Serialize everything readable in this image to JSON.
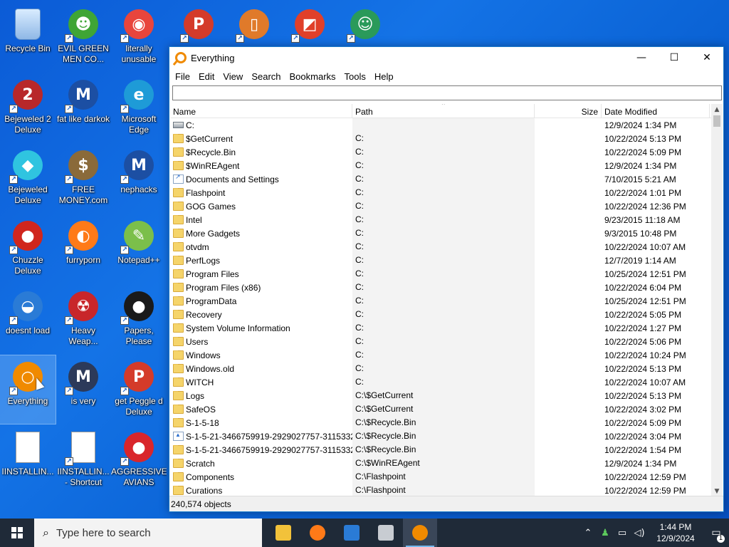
{
  "desktop": {
    "icons": [
      {
        "label": "Recycle Bin",
        "glyph": "",
        "color": "#cfe6ff",
        "shortcut": false
      },
      {
        "label": "EVIL GREEN MEN CO...",
        "glyph": "☻",
        "color": "#3fa535",
        "shortcut": true
      },
      {
        "label": "literally unusable",
        "glyph": "◉",
        "color": "#e8453c",
        "shortcut": true
      },
      {
        "label": "Bejeweled 2 Deluxe",
        "glyph": "2",
        "color": "#b8282a",
        "shortcut": true
      },
      {
        "label": "fat like darkok",
        "glyph": "M",
        "color": "#1c4fa3",
        "shortcut": true
      },
      {
        "label": "Microsoft Edge",
        "glyph": "e",
        "color": "#1e9bd7",
        "shortcut": true
      },
      {
        "label": "Bejeweled Deluxe",
        "glyph": "◆",
        "color": "#2fc4e0",
        "shortcut": true
      },
      {
        "label": "FREE MONEY.com",
        "glyph": "$",
        "color": "#8a6a3a",
        "shortcut": true
      },
      {
        "label": "nephacks",
        "glyph": "M",
        "color": "#1c4fa3",
        "shortcut": true
      },
      {
        "label": "Chuzzle Deluxe",
        "glyph": "●",
        "color": "#d0261d",
        "shortcut": true
      },
      {
        "label": "furryporn",
        "glyph": "◐",
        "color": "#ff7a18",
        "shortcut": true
      },
      {
        "label": "Notepad++",
        "glyph": "✎",
        "color": "#7bbf4a",
        "shortcut": true
      },
      {
        "label": "doesnt load",
        "glyph": "◒",
        "color": "#2a7bd6",
        "shortcut": true
      },
      {
        "label": "Heavy Weap...",
        "glyph": "☢",
        "color": "#c8262a",
        "shortcut": true
      },
      {
        "label": "Papers, Please",
        "glyph": "●",
        "color": "#1a1a1a",
        "shortcut": true
      },
      {
        "label": "Everything",
        "glyph": "○",
        "color": "#f08a00",
        "shortcut": true
      },
      {
        "label": "is very",
        "glyph": "M",
        "color": "#2c3a5a",
        "shortcut": true
      },
      {
        "label": "get Peggle d Deluxe",
        "glyph": "P",
        "color": "#d43b2a",
        "shortcut": true
      },
      {
        "label": "IINSTALLIN...",
        "glyph": "",
        "color": "#ffffff",
        "shortcut": false
      },
      {
        "label": "IINSTALLIN... - Shortcut",
        "glyph": "",
        "color": "#ffffff",
        "shortcut": true
      },
      {
        "label": "AGGRESSIVE AVIANS",
        "glyph": "●",
        "color": "#d9262b",
        "shortcut": true
      }
    ],
    "top_partial_icons": [
      {
        "glyph": "P",
        "color": "#d43b2a"
      },
      {
        "glyph": "▯",
        "color": "#e07a2a"
      },
      {
        "glyph": "◩",
        "color": "#e0402a"
      },
      {
        "glyph": "☺",
        "color": "#2a9a5a"
      }
    ]
  },
  "window": {
    "title": "Everything",
    "controls": {
      "minimize": "—",
      "maximize": "☐",
      "close": "✕"
    },
    "menu": [
      "File",
      "Edit",
      "View",
      "Search",
      "Bookmarks",
      "Tools",
      "Help"
    ],
    "search": {
      "value": "",
      "placeholder": ""
    },
    "columns": {
      "name": "Name",
      "path": "Path",
      "size": "Size",
      "date": "Date Modified"
    },
    "rows": [
      {
        "name": "C:",
        "path": "",
        "date": "12/9/2024 1:34 PM",
        "icon": "drive"
      },
      {
        "name": "$GetCurrent",
        "path": "C:",
        "date": "10/22/2024 5:13 PM",
        "icon": "folder"
      },
      {
        "name": "$Recycle.Bin",
        "path": "C:",
        "date": "10/22/2024 5:09 PM",
        "icon": "folder"
      },
      {
        "name": "$WinREAgent",
        "path": "C:",
        "date": "12/9/2024 1:34 PM",
        "icon": "folder"
      },
      {
        "name": "Documents and Settings",
        "path": "C:",
        "date": "7/10/2015 5:21 AM",
        "icon": "link"
      },
      {
        "name": "Flashpoint",
        "path": "C:",
        "date": "10/22/2024 1:01 PM",
        "icon": "folder"
      },
      {
        "name": "GOG Games",
        "path": "C:",
        "date": "10/22/2024 12:36 PM",
        "icon": "folder"
      },
      {
        "name": "Intel",
        "path": "C:",
        "date": "9/23/2015 11:18 AM",
        "icon": "folder"
      },
      {
        "name": "More Gadgets",
        "path": "C:",
        "date": "9/3/2015 10:48 PM",
        "icon": "folder"
      },
      {
        "name": "otvdm",
        "path": "C:",
        "date": "10/22/2024 10:07 AM",
        "icon": "folder"
      },
      {
        "name": "PerfLogs",
        "path": "C:",
        "date": "12/7/2019 1:14 AM",
        "icon": "folder"
      },
      {
        "name": "Program Files",
        "path": "C:",
        "date": "10/25/2024 12:51 PM",
        "icon": "folder"
      },
      {
        "name": "Program Files (x86)",
        "path": "C:",
        "date": "10/22/2024 6:04 PM",
        "icon": "folder"
      },
      {
        "name": "ProgramData",
        "path": "C:",
        "date": "10/25/2024 12:51 PM",
        "icon": "folder"
      },
      {
        "name": "Recovery",
        "path": "C:",
        "date": "10/22/2024 5:05 PM",
        "icon": "folder"
      },
      {
        "name": "System Volume Information",
        "path": "C:",
        "date": "10/22/2024 1:27 PM",
        "icon": "folder"
      },
      {
        "name": "Users",
        "path": "C:",
        "date": "10/22/2024 5:06 PM",
        "icon": "folder"
      },
      {
        "name": "Windows",
        "path": "C:",
        "date": "10/22/2024 10:24 PM",
        "icon": "folder"
      },
      {
        "name": "Windows.old",
        "path": "C:",
        "date": "10/22/2024 5:13 PM",
        "icon": "folder"
      },
      {
        "name": "WITCH",
        "path": "C:",
        "date": "10/22/2024 10:07 AM",
        "icon": "folder"
      },
      {
        "name": "Logs",
        "path": "C:\\$GetCurrent",
        "date": "10/22/2024 5:13 PM",
        "icon": "folder"
      },
      {
        "name": "SafeOS",
        "path": "C:\\$GetCurrent",
        "date": "10/22/2024 3:02 PM",
        "icon": "folder"
      },
      {
        "name": "S-1-5-18",
        "path": "C:\\$Recycle.Bin",
        "date": "10/22/2024 5:09 PM",
        "icon": "folder"
      },
      {
        "name": "S-1-5-21-3466759919-2929027757-3115332...",
        "path": "C:\\$Recycle.Bin",
        "date": "10/22/2024 3:04 PM",
        "icon": "sid"
      },
      {
        "name": "S-1-5-21-3466759919-2929027757-3115332...",
        "path": "C:\\$Recycle.Bin",
        "date": "10/22/2024 1:54 PM",
        "icon": "folder"
      },
      {
        "name": "Scratch",
        "path": "C:\\$WinREAgent",
        "date": "12/9/2024 1:34 PM",
        "icon": "folder"
      },
      {
        "name": "Components",
        "path": "C:\\Flashpoint",
        "date": "10/22/2024 12:59 PM",
        "icon": "folder"
      },
      {
        "name": "Curations",
        "path": "C:\\Flashpoint",
        "date": "10/22/2024 12:59 PM",
        "icon": "folder"
      }
    ],
    "status": "240,574 objects"
  },
  "taskbar": {
    "search_placeholder": "Type here to search",
    "apps": [
      {
        "name": "file-explorer",
        "color": "#f2c23a"
      },
      {
        "name": "firefox",
        "color": "#ff7a18"
      },
      {
        "name": "photos",
        "color": "#2a7bd6"
      },
      {
        "name": "generic-app",
        "color": "#c8ccd2"
      },
      {
        "name": "everything",
        "color": "#f08a00"
      }
    ],
    "time": "1:44 PM",
    "date": "12/9/2024",
    "notification_count": "1"
  }
}
